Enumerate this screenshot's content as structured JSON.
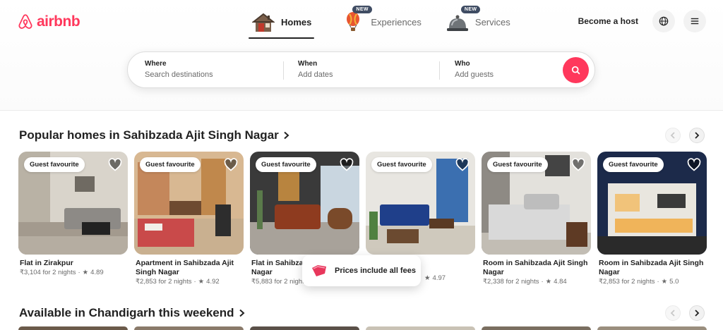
{
  "brand": {
    "name": "airbnb",
    "color": "#ff385c"
  },
  "nav": {
    "tabs": [
      {
        "label": "Homes",
        "active": true,
        "icon": "house-icon"
      },
      {
        "label": "Experiences",
        "badge": "NEW",
        "icon": "hot-air-balloon-icon"
      },
      {
        "label": "Services",
        "badge": "NEW",
        "icon": "service-bell-icon"
      }
    ]
  },
  "header": {
    "become_host": "Become a host",
    "globe_icon": "globe-icon",
    "menu_icon": "menu-icon"
  },
  "search": {
    "where_label": "Where",
    "where_placeholder": "Search destinations",
    "when_label": "When",
    "when_placeholder": "Add dates",
    "who_label": "Who",
    "who_placeholder": "Add guests",
    "button_icon": "search-icon"
  },
  "section1": {
    "title": "Popular homes in Sahibzada Ajit Singh Nagar",
    "listings": [
      {
        "badge": "Guest favourite",
        "title": "Flat in Zirakpur",
        "price": "₹3,104 for 2 nights",
        "rating": "4.89"
      },
      {
        "badge": "Guest favourite",
        "title": "Apartment in Sahibzada Ajit Singh Nagar",
        "price": "₹2,853 for 2 nights",
        "rating": "4.92"
      },
      {
        "badge": "Guest favourite",
        "title": "Flat in Sahibzada Ajit Singh Nagar",
        "price": "₹5,883 for 2 nights",
        "rating": "4.97"
      },
      {
        "badge": "Guest favourite",
        "title": "",
        "price": "",
        "rating": "4.97"
      },
      {
        "badge": "Guest favourite",
        "title": "Room in Sahibzada Ajit Singh Nagar",
        "price": "₹2,338 for 2 nights",
        "rating": "4.84"
      },
      {
        "badge": "Guest favourite",
        "title": "Room in Sahibzada Ajit Singh Nagar",
        "price": "₹2,853 for 2 nights",
        "rating": "5.0"
      }
    ]
  },
  "section2": {
    "title": "Available in Chandigarh this weekend"
  },
  "toast": {
    "text": "Prices include all fees",
    "icon": "price-tag-icon"
  }
}
